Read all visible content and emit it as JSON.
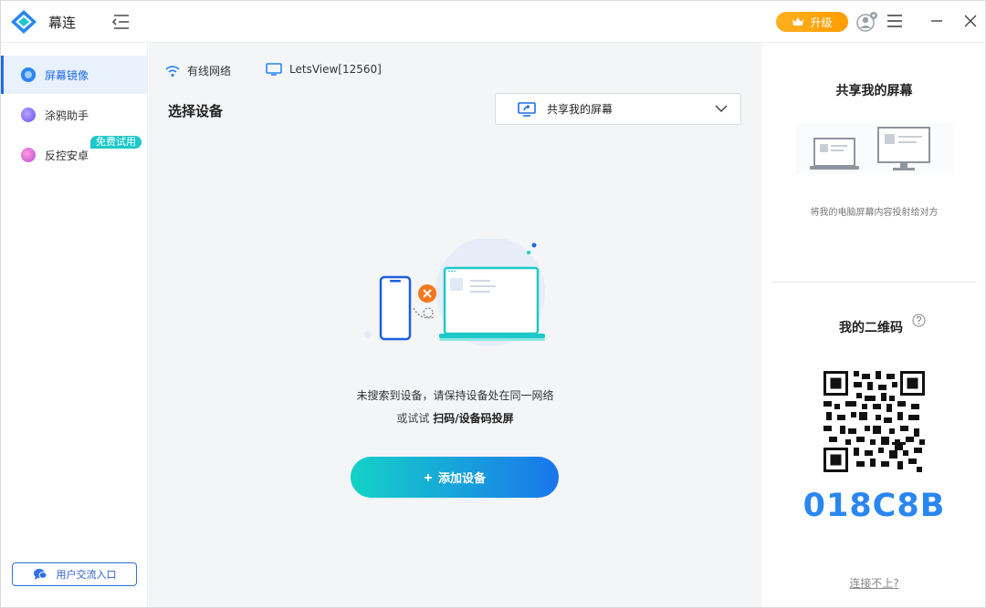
{
  "app": {
    "title": "幕连"
  },
  "header": {
    "upgrade_label": "升级"
  },
  "sidebar": {
    "items": [
      {
        "label": "屏幕镜像"
      },
      {
        "label": "涂鸦助手"
      },
      {
        "label": "反控安卓"
      }
    ],
    "trial_badge": "免费试用",
    "community_label": "用户交流入口"
  },
  "main": {
    "network_label": "有线网络",
    "device_name": "LetsView[12560]",
    "section_title": "选择设备",
    "share_select": "共享我的屏幕",
    "empty_message": "未搜索到设备，请保持设备处在同一网络",
    "empty_hint_prefix": "或试试",
    "empty_hint_action": "扫码/设备码投屏",
    "add_button": "添加设备"
  },
  "right_panel": {
    "share_title": "共享我的屏幕",
    "share_desc": "将我的电脑屏幕内容投射给对方",
    "qr_title": "我的二维码",
    "code": "018C8B",
    "cant_connect": "连接不上?"
  },
  "colors": {
    "accent": "#1e6be6",
    "upgrade": "#ffa70f",
    "code": "#2a86f0",
    "trial_badge": "#1ec8c8"
  },
  "icons": {
    "logo": "diamond-logo-icon",
    "collapse": "collapse-sidebar-icon",
    "upgrade": "crown-icon",
    "user": "user-settings-icon",
    "menu": "hamburger-icon",
    "minimize": "minimize-icon",
    "close": "close-icon",
    "network": "wifi-icon",
    "monitor": "monitor-icon",
    "chevron": "chevron-down-icon",
    "help": "question-icon",
    "community": "chat-icon"
  }
}
